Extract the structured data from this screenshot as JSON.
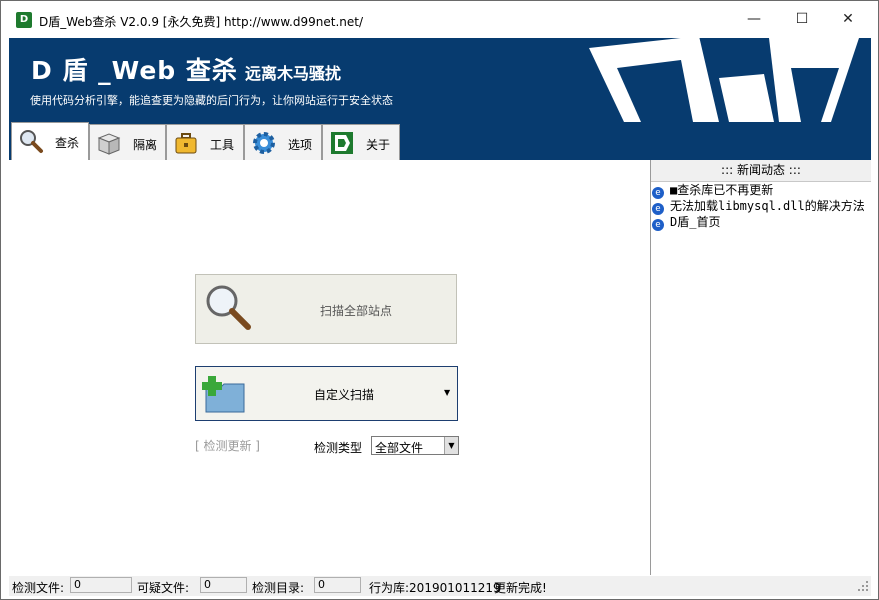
{
  "window": {
    "title": "D盾_Web查杀 V2.0.9 [永久免费] http://www.d99net.net/",
    "app_icon_label": "D",
    "minimize": "—",
    "maximize": "☐",
    "close": "✕"
  },
  "banner": {
    "title": "D 盾 _Web 查杀",
    "slogan": "远离木马骚扰",
    "subtitle": "使用代码分析引擎，能追查更为隐藏的后门行为，让你网站运行于安全状态",
    "brand_color": "#073b6f"
  },
  "tabs": [
    {
      "label": "查杀",
      "icon": "magnifier-icon",
      "active": true
    },
    {
      "label": "隔离",
      "icon": "box-icon",
      "active": false
    },
    {
      "label": "工具",
      "icon": "briefcase-icon",
      "active": false
    },
    {
      "label": "选项",
      "icon": "gear-icon",
      "active": false
    },
    {
      "label": "关于",
      "icon": "d-logo-icon",
      "active": false
    }
  ],
  "scan": {
    "scan_all_label": "扫描全部站点",
    "custom_scan_label": "自定义扫描",
    "update_link": "[ 检测更新 ]",
    "detect_type_label": "检测类型",
    "detect_type_value": "全部文件"
  },
  "news": {
    "header": "::: 新闻动态 :::",
    "items": [
      "■查杀库已不再更新",
      "无法加载libmysql.dll的解决方法",
      "D盾_首页"
    ]
  },
  "status": {
    "files_label": "检测文件:",
    "files_value": "0",
    "suspicious_label": "可疑文件:",
    "suspicious_value": "0",
    "dirs_label": "检测目录:",
    "dirs_value": "0",
    "library_text": "行为库:201901011219",
    "update_text": "更新完成!"
  }
}
